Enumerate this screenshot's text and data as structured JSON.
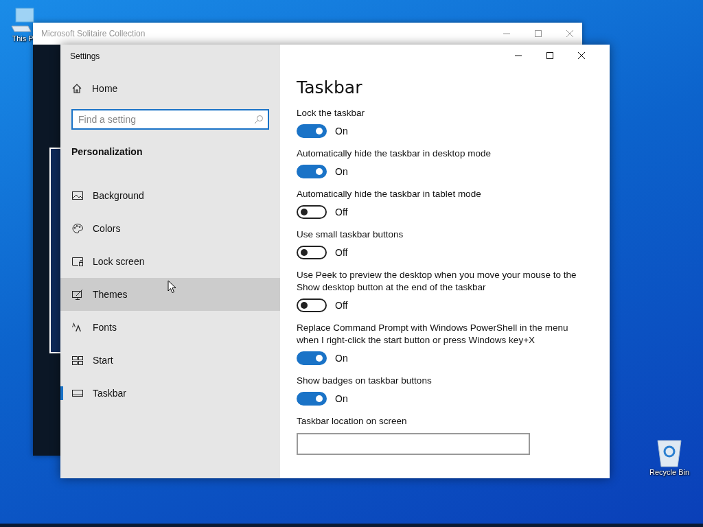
{
  "desktop_icons": [
    {
      "label": "This P",
      "kind": "computer"
    },
    {
      "label": "Recycle Bin",
      "kind": "bin"
    }
  ],
  "background_window": {
    "title": "Microsoft Solitaire Collection"
  },
  "window": {
    "title": "Settings"
  },
  "sidebar": {
    "home": "Home",
    "search": {
      "placeholder": "Find a setting"
    },
    "section": "Personalization",
    "items": [
      {
        "label": "Background",
        "kind": "picture",
        "selected": false,
        "hovered": false
      },
      {
        "label": "Colors",
        "kind": "palette",
        "selected": false,
        "hovered": false
      },
      {
        "label": "Lock screen",
        "kind": "lock",
        "selected": false,
        "hovered": false
      },
      {
        "label": "Themes",
        "kind": "brush",
        "selected": false,
        "hovered": true
      },
      {
        "label": "Fonts",
        "kind": "fonts",
        "selected": false,
        "hovered": false
      },
      {
        "label": "Start",
        "kind": "start",
        "selected": false,
        "hovered": false
      },
      {
        "label": "Taskbar",
        "kind": "taskbar",
        "selected": true,
        "hovered": false
      }
    ]
  },
  "page": {
    "title": "Taskbar",
    "settings": [
      {
        "label": "Lock the taskbar",
        "on": true,
        "state": "On"
      },
      {
        "label": "Automatically hide the taskbar in desktop mode",
        "on": true,
        "state": "On"
      },
      {
        "label": "Automatically hide the taskbar in tablet mode",
        "on": false,
        "state": "Off"
      },
      {
        "label": "Use small taskbar buttons",
        "on": false,
        "state": "Off"
      },
      {
        "label": "Use Peek to preview the desktop when you move your mouse to the Show desktop button at the end of the taskbar",
        "on": false,
        "state": "Off"
      },
      {
        "label": "Replace Command Prompt with Windows PowerShell in the menu when I right-click the start button or press Windows key+X",
        "on": true,
        "state": "On"
      },
      {
        "label": "Show badges on taskbar buttons",
        "on": true,
        "state": "On"
      }
    ],
    "location_label": "Taskbar location on screen"
  }
}
